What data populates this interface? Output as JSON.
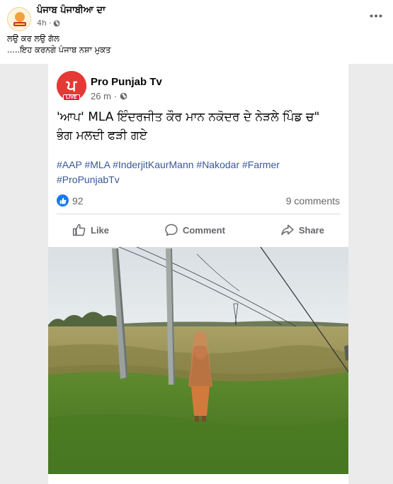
{
  "outer_post": {
    "page_name": "ਪੰਜਾਬ ਪੰਜਾਬੀਆ ਦਾ",
    "time": "4h",
    "privacy_icon": "globe-icon",
    "more_icon": "ellipsis-icon",
    "caption_line1": "ਲਉ ਕਰ ਲਉ ਗੱਲ",
    "caption_line2": ".....ਇਹ ਕਰਨਗੇ ਪੰਜਾਬ ਨਸ਼ਾ ਮੁਕਤ"
  },
  "shared_post": {
    "page_name": "Pro Punjab Tv",
    "avatar_glyph": "ਪ",
    "live_badge": "LIVE",
    "time": "26 m",
    "privacy_icon": "globe-icon",
    "text_line1": "'ਆਪ' MLA ਇੰਦਰਜੀਤ ਕੌਰ ਮਾਨ ਨਕੋਦਰ ਦੇ ਨੇੜਲੇ ਪਿੰਡ ਚ\"",
    "text_line2": "ਭੰਗ ਮਲਦੀ ਫੜੀ ਗਏ",
    "hashtags_line1": "#AAP #MLA #InderjitKaurMann #Nakodar #Farmer",
    "hashtags_line2": "#ProPunjabTv",
    "reaction_count": "92",
    "comments_count": "9 comments",
    "actions": {
      "like": "Like",
      "comment": "Comment",
      "share": "Share"
    }
  },
  "colors": {
    "brand_blue": "#1877f2",
    "hashtag": "#385898",
    "avatar_red": "#e53935",
    "secondary_text": "#65676b",
    "shared_background": "#ebebeb"
  }
}
